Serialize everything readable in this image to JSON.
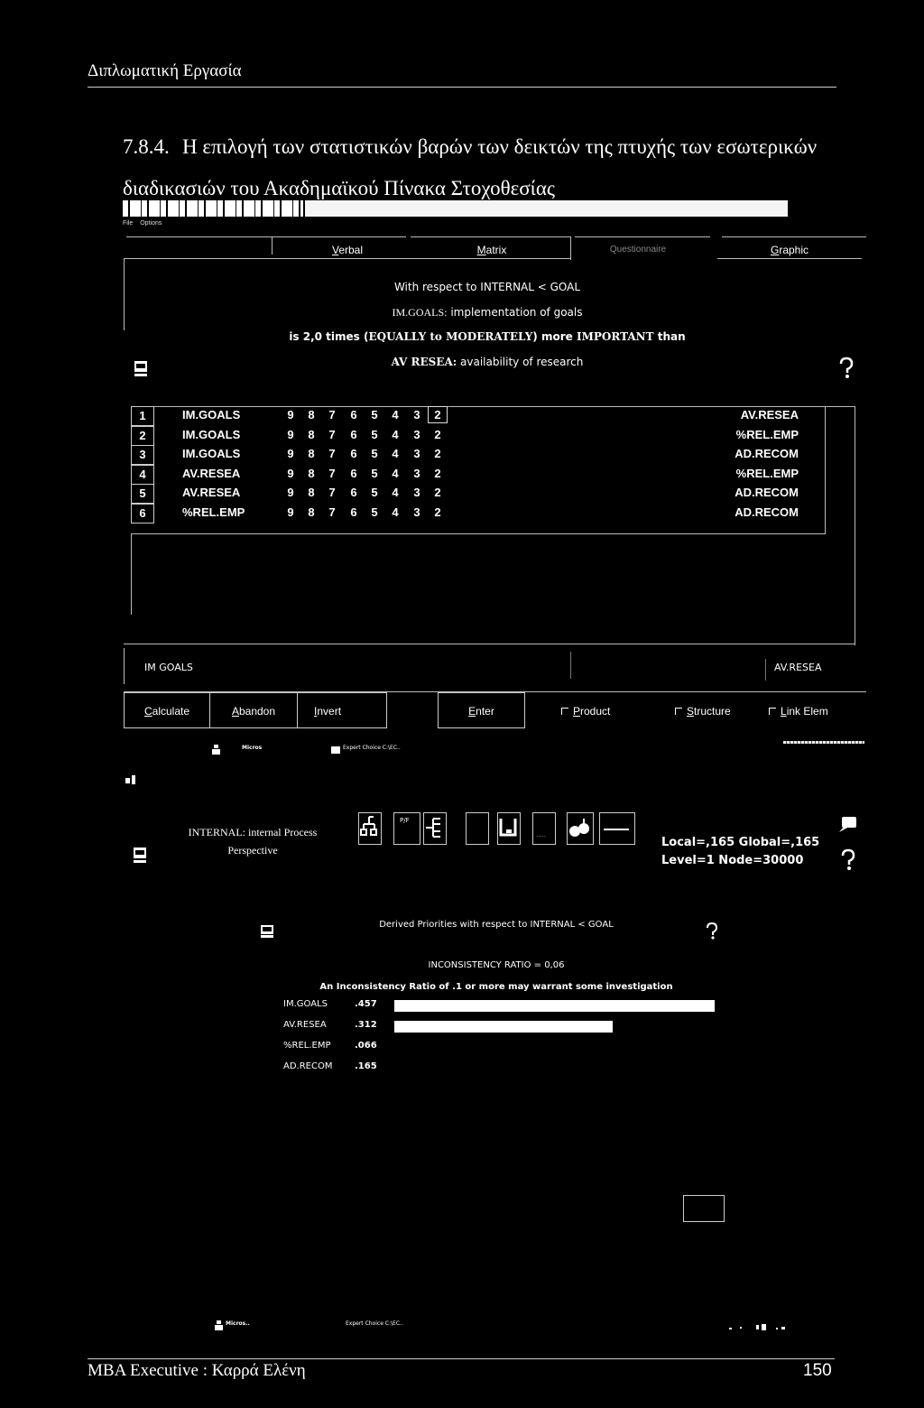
{
  "document": {
    "header": "Διπλωματική Εργασία",
    "section_number": "7.8.4.",
    "section_title": "Η επιλογή των στατιστικών βαρών των δεικτών της πτυχής των εσωτερικών διαδικασιών του Ακαδημαϊκού Πίνακα Στοχοθεσίας",
    "footer_left": "MBA  Executive :  Καρρά Ελένη",
    "footer_page": "150"
  },
  "app": {
    "menu": [
      "File",
      "Options"
    ],
    "tabs": [
      {
        "label": "Verbal",
        "accel": "V",
        "rest": "erbal"
      },
      {
        "label": "Matrix",
        "accel": "M",
        "rest": "atrix"
      },
      {
        "label": "Questionnaire",
        "accel": "",
        "rest": "Questionnaire"
      },
      {
        "label": "Graphic",
        "accel": "G",
        "rest": "raphic"
      }
    ],
    "verbal": {
      "line1": "With respect to INTERNAL < GOAL",
      "line2_code": "IM.GOALS:",
      "line2_desc": " implementation of goals",
      "line3_pre": "is 2,0 times (",
      "line3_strength": "EQUALLY to MODERATELY",
      "line3_mid": ") more ",
      "line3_important": "IMPORTANT",
      "line3_post": " than",
      "line4_code": "AV RESEA:",
      "line4_desc": " availability of research"
    },
    "comparisons": {
      "scale": [
        "9",
        "8",
        "7",
        "6",
        "5",
        "4",
        "3",
        "2"
      ],
      "rows": [
        {
          "n": "1",
          "left": "IM.GOALS",
          "right": "AV.RESEA",
          "selected": "2"
        },
        {
          "n": "2",
          "left": "IM.GOALS",
          "right": "%REL.EMP",
          "selected": ""
        },
        {
          "n": "3",
          "left": "IM.GOALS",
          "right": "AD.RECOM",
          "selected": ""
        },
        {
          "n": "4",
          "left": "AV.RESEA",
          "right": "%REL.EMP",
          "selected": ""
        },
        {
          "n": "5",
          "left": "AV.RESEA",
          "right": "AD.RECOM",
          "selected": ""
        },
        {
          "n": "6",
          "left": "%REL.EMP",
          "right": "AD.RECOM",
          "selected": ""
        }
      ]
    },
    "slider": {
      "left_label": "IM GOALS",
      "right_label": "AV.RESEA"
    },
    "buttons": {
      "calculate": {
        "accel": "C",
        "rest": "alculate"
      },
      "abandon": {
        "accel": "A",
        "rest": "bandon"
      },
      "invert": {
        "accel": "I",
        "rest": "nvert"
      },
      "enter": {
        "accel": "E",
        "rest": "nter"
      }
    },
    "checkboxes": [
      {
        "accel": "P",
        "rest": "roduct",
        "checked": false
      },
      {
        "accel": "S",
        "rest": "tructure",
        "checked": false
      },
      {
        "accel": "L",
        "rest": "ink Elem",
        "checked": false
      }
    ],
    "taskbar": {
      "item1": "Micros",
      "item2": "Expert Choice  C:\\EC.."
    },
    "node": {
      "name_line1": "INTERNAL: internal Process",
      "name_line2": "Perspective",
      "local_global": "Local=,165 Global=,165",
      "level_node": "Level=1  Node=30000"
    },
    "toolbar_icons": [
      "hierarchy-icon",
      "pf-icon",
      "tree-icon",
      "blank-icon",
      "save-icon",
      "dots-icon",
      "fruit-icon",
      "line-icon"
    ],
    "toolbar_pf_label": "P/F",
    "priorities": {
      "title": "Derived Priorities with respect to INTERNAL < GOAL",
      "inconsistency": "INCONSISTENCY RATIO = 0,06",
      "note": "An Inconsistency Ratio of .1 or more may warrant some investigation",
      "items": [
        {
          "label": "IM.GOALS",
          "value": ".457",
          "weight": 0.457
        },
        {
          "label": "AV.RESEA",
          "value": ".312",
          "weight": 0.312
        },
        {
          "label": "%REL.EMP",
          "value": ".066",
          "weight": 0.066
        },
        {
          "label": "AD.RECOM",
          "value": ".165",
          "weight": 0.165
        }
      ]
    },
    "bottom_taskbar": {
      "item1": "Micros..",
      "item2": "Expert Choice  C:\\EC.."
    }
  }
}
